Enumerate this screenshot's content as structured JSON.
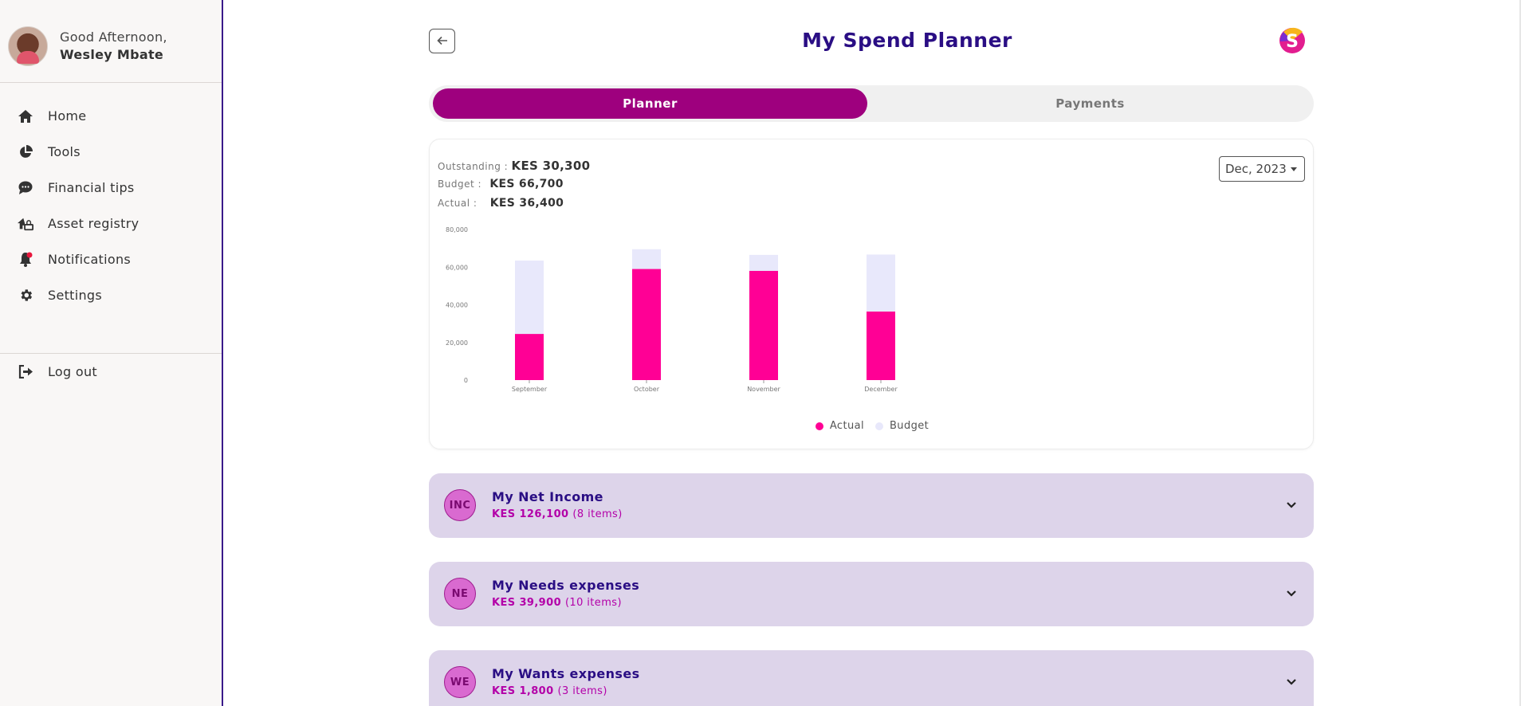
{
  "user": {
    "greeting": "Good Afternoon,",
    "name": "Wesley Mbate"
  },
  "nav": [
    {
      "label": "Home",
      "icon": "home-icon"
    },
    {
      "label": "Tools",
      "icon": "pie-chart-icon"
    },
    {
      "label": "Financial tips",
      "icon": "chat-bubble-icon"
    },
    {
      "label": "Asset registry",
      "icon": "house-key-icon"
    },
    {
      "label": "Notifications",
      "icon": "bell-icon"
    },
    {
      "label": "Settings",
      "icon": "gear-icon"
    }
  ],
  "logout": {
    "label": "Log out",
    "icon": "logout-icon"
  },
  "header": {
    "title": "My Spend Planner",
    "back_icon": "back-arrow-icon",
    "logo_letter": "S"
  },
  "tabs": [
    {
      "label": "Planner",
      "active": true
    },
    {
      "label": "Payments",
      "active": false
    }
  ],
  "summary": {
    "outstanding_label": "Outstanding :",
    "outstanding_value": "KES 30,300",
    "budget_label": "Budget :",
    "budget_value": "KES 66,700",
    "actual_label": "Actual :",
    "actual_value": "KES 36,400"
  },
  "month_select": {
    "value": "Dec, 2023"
  },
  "chart_data": {
    "type": "bar",
    "stacked": true,
    "categories": [
      "September",
      "October",
      "November",
      "December"
    ],
    "series": [
      {
        "name": "Actual",
        "color": "#ff0095",
        "values": [
          24500,
          59000,
          58000,
          36400
        ]
      },
      {
        "name": "Budget",
        "color": "#e8e8fb",
        "values": [
          63500,
          69500,
          66500,
          66700
        ]
      }
    ],
    "yticks": [
      "0",
      "20,000",
      "40,000",
      "60,000",
      "80,000"
    ],
    "ylim": [
      0,
      80000
    ],
    "legend_position": "bottom-center",
    "grid": false
  },
  "categories": [
    {
      "badge": "INC",
      "title": "My Net Income",
      "amount": "KES 126,100",
      "items": "(8 items)"
    },
    {
      "badge": "NE",
      "title": "My Needs expenses",
      "amount": "KES 39,900",
      "items": "(10 items)"
    },
    {
      "badge": "WE",
      "title": "My Wants expenses",
      "amount": "KES 1,800",
      "items": "(3 items)"
    }
  ],
  "colors": {
    "brand_primary": "#9e007e",
    "title": "#2a0e84",
    "actual": "#ff0095",
    "budget": "#e8e8fb",
    "accordion_bg": "#ddd4ea"
  }
}
